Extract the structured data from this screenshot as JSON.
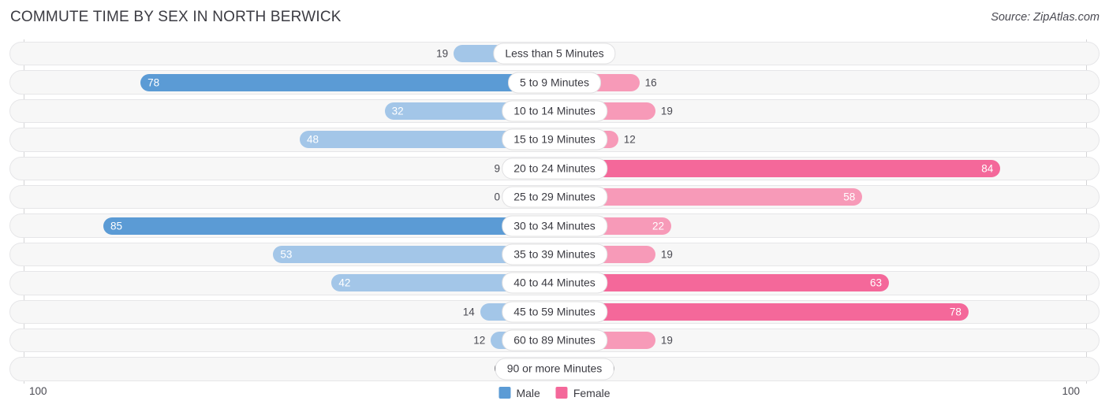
{
  "header": {
    "title": "COMMUTE TIME BY SEX IN NORTH BERWICK",
    "source": "Source: ZipAtlas.com"
  },
  "legend": {
    "male_label": "Male",
    "female_label": "Female",
    "male_color": "#5b9bd5",
    "female_color": "#f4689a"
  },
  "axis": {
    "left_tick": "100",
    "right_tick": "100"
  },
  "chart_data": {
    "type": "bar",
    "title": "COMMUTE TIME BY SEX IN NORTH BERWICK",
    "subtitle": "",
    "xlabel": "",
    "ylabel": "",
    "orientation": "horizontal-diverging",
    "grid": false,
    "legend_position": "bottom-center",
    "axis_max": 100,
    "axis_min": 0,
    "xlim": [
      100,
      100
    ],
    "tick_labels": [
      "100",
      "100"
    ],
    "categories": [
      "Less than 5 Minutes",
      "5 to 9 Minutes",
      "10 to 14 Minutes",
      "15 to 19 Minutes",
      "20 to 24 Minutes",
      "25 to 29 Minutes",
      "30 to 34 Minutes",
      "35 to 39 Minutes",
      "40 to 44 Minutes",
      "45 to 59 Minutes",
      "60 to 89 Minutes",
      "90 or more Minutes"
    ],
    "series": [
      {
        "name": "Male",
        "color": "#5b9bd5",
        "direction": "left",
        "values": [
          19,
          78,
          32,
          48,
          9,
          0,
          85,
          53,
          42,
          14,
          12,
          0
        ],
        "labels": [
          "19",
          "78",
          "32",
          "48",
          "9",
          "0",
          "85",
          "53",
          "42",
          "14",
          "12",
          "0"
        ]
      },
      {
        "name": "Female",
        "color": "#f4689a",
        "direction": "right",
        "values": [
          0,
          16,
          19,
          12,
          84,
          58,
          22,
          19,
          63,
          78,
          19,
          0
        ],
        "labels": [
          "0",
          "16",
          "19",
          "12",
          "84",
          "58",
          "22",
          "19",
          "63",
          "78",
          "19",
          "0"
        ]
      }
    ]
  }
}
